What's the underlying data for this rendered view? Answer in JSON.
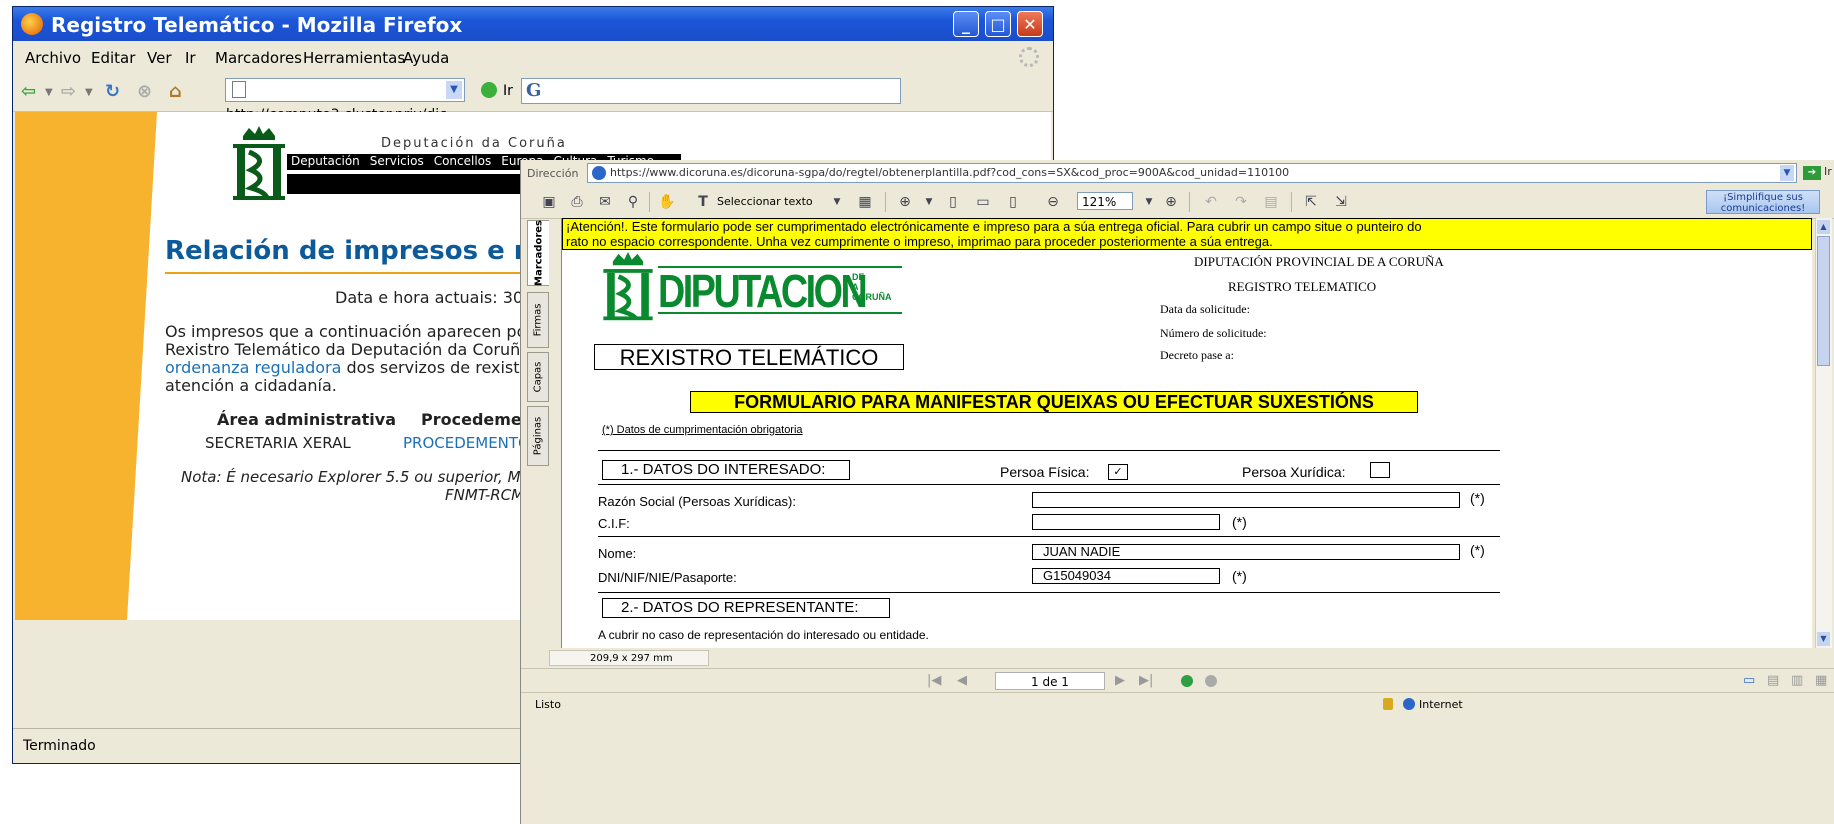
{
  "firefox": {
    "title": "Registro Telemático - Mozilla Firefox",
    "menu": [
      "Archivo",
      "Editar",
      "Ver",
      "Ir",
      "Marcadores",
      "Herramientas",
      "Ayuda"
    ],
    "url": "http://compute3.cluster.priv/dic",
    "go_label": "Ir",
    "search_engine_glyph": "G",
    "page": {
      "dep_name": "Deputación da Coruña",
      "nav": [
        "Deputación",
        "Servicios",
        "Concellos",
        "Europa",
        "Cultura",
        "Turismo"
      ],
      "heading": "Relación de impresos e m",
      "datetime": "Data e hora actuais: 30/",
      "intro_line1": "Os impresos que a continuación aparecen póc",
      "intro_line2": "Rexistro Telemático da Deputación da Coruña",
      "intro_link": "ordenanza reguladora",
      "intro_line3_rest": " dos servizos de rexistr",
      "intro_line4": "atención a cidadanía.",
      "col1_header": "Área administrativa",
      "col2_header": "Procedemen",
      "col1_value": "SECRETARIA XERAL",
      "col2_value": "PROCEDEMENTO",
      "note_line1": "Nota: É necesario Explorer 5.5 ou superior, Mc",
      "note_line2": "FNMT-RCM"
    },
    "status": "Terminado"
  },
  "pdf": {
    "address_label": "Dirección",
    "address": "https://www.dicoruna.es/dicoruna-sgpa/do/regtel/obtenerplantilla.pdf?cod_cons=SX&cod_proc=900A&cod_unidad=110100",
    "go_label": "Ir",
    "select_text": "Seleccionar texto",
    "zoom": "121%",
    "adv_line1": "¡Simplifique sus",
    "adv_line2": "comunicaciones!",
    "side_tabs": [
      "Marcadores",
      "Firmas",
      "Capas",
      "Páginas"
    ],
    "warning_line1": "¡Atención!. Este formulario pode ser cumprimentado electrónicamente e impreso para a súa entrega oficial. Para cubrir un campo situe o punteiro do",
    "warning_line2": "rato no espacio correspondente. Unha vez cumprimente o  impreso, imprimao para proceder posteriormente a súa entrega.",
    "logo_word": "DIPUTACION",
    "logo_small": [
      "DE",
      "A",
      "CORUÑA"
    ],
    "header_right": {
      "line1": "DIPUTACIÓN PROVINCIAL DE A CORUÑA",
      "line2": "REGISTRO TELEMATICO",
      "line3": "Data da solicitude:",
      "line4": "Número de solicitude:",
      "line5": "Decreto pase a:"
    },
    "rexistro": "REXISTRO TELEMÁTICO",
    "form_title": "FORMULARIO PARA MANIFESTAR QUEIXAS OU EFECTUAR SUXESTIÓNS",
    "obligatory_note": "(*) Datos de cumprimentación obrigatoria",
    "section1": "1.- DATOS DO INTERESADO:",
    "persoa_fisica": "Persoa Física:",
    "persoa_xuridica": "Persoa Xurídica:",
    "persoa_fisica_checked": true,
    "fields": {
      "razon_social_label": "Razón Social (Persoas Xurídicas):",
      "razon_social_value": "",
      "cif_label": "C.I.F:",
      "cif_value": "",
      "nome_label": "Nome:",
      "nome_value": "JUAN NADIE",
      "dni_label": "DNI/NIF/NIE/Pasaporte:",
      "dni_value": "G15049034"
    },
    "required_mark": "(*)",
    "section2": "2.- DATOS DO REPRESENTANTE:",
    "section2_note": "A cubrir no caso de representación do interesado ou entidade.",
    "page_size": "209,9 x 297 mm",
    "page_nav": "1 de 1",
    "status": "Listo",
    "zone": "Internet"
  }
}
